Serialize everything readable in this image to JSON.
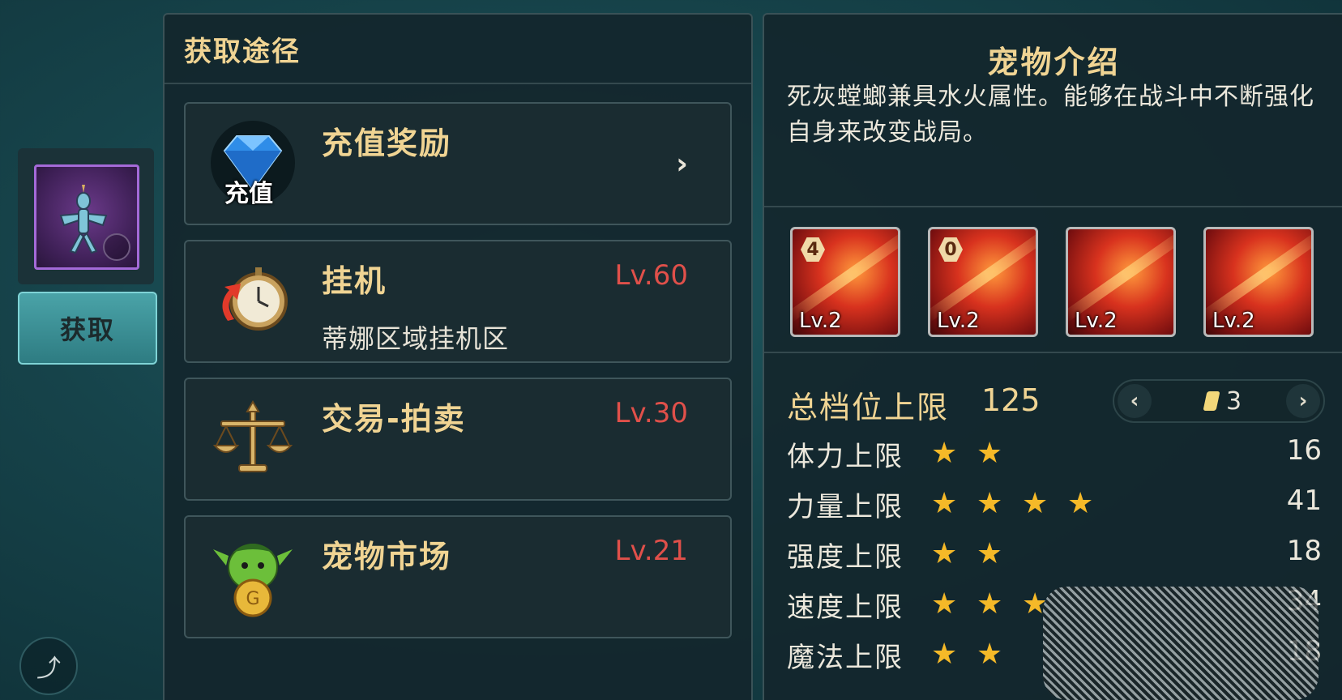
{
  "left": {
    "get_button": "获取"
  },
  "sources": {
    "title": "获取途径",
    "items": [
      {
        "name": "充值奖励",
        "level": "",
        "desc": "",
        "icon_label": "充值",
        "icon": "diamond-icon"
      },
      {
        "name": "挂机",
        "level": "Lv.60",
        "desc": "蒂娜区域挂机区",
        "icon": "pocket-watch-icon"
      },
      {
        "name": "交易-拍卖",
        "level": "Lv.30",
        "desc": "",
        "icon": "scales-icon"
      },
      {
        "name": "宠物市场",
        "level": "Lv.21",
        "desc": "",
        "icon": "goblin-coin-icon"
      }
    ]
  },
  "pet": {
    "title": "宠物介绍",
    "description": "死灰螳螂兼具水火属性。能够在战斗中不断强化自身来改变战局。",
    "skills": [
      {
        "level": "Lv.2",
        "badge": "4"
      },
      {
        "level": "Lv.2",
        "badge": "0"
      },
      {
        "level": "Lv.2",
        "badge": ""
      },
      {
        "level": "Lv.2",
        "badge": ""
      }
    ],
    "cap": {
      "label": "总档位上限",
      "value": "125",
      "tier": "3"
    },
    "stats": [
      {
        "label": "体力上限",
        "stars": 1.5,
        "value": "16"
      },
      {
        "label": "力量上限",
        "stars": 4,
        "value": "41"
      },
      {
        "label": "强度上限",
        "stars": 1.5,
        "value": "18"
      },
      {
        "label": "速度上限",
        "stars": 2.5,
        "value": "34"
      },
      {
        "label": "魔法上限",
        "stars": 1.5,
        "value": "18"
      }
    ]
  },
  "colors": {
    "title_gold": "#f0d493",
    "level_red": "#e0504a",
    "star": "#f5b928",
    "button_teal": "#3f9398"
  }
}
